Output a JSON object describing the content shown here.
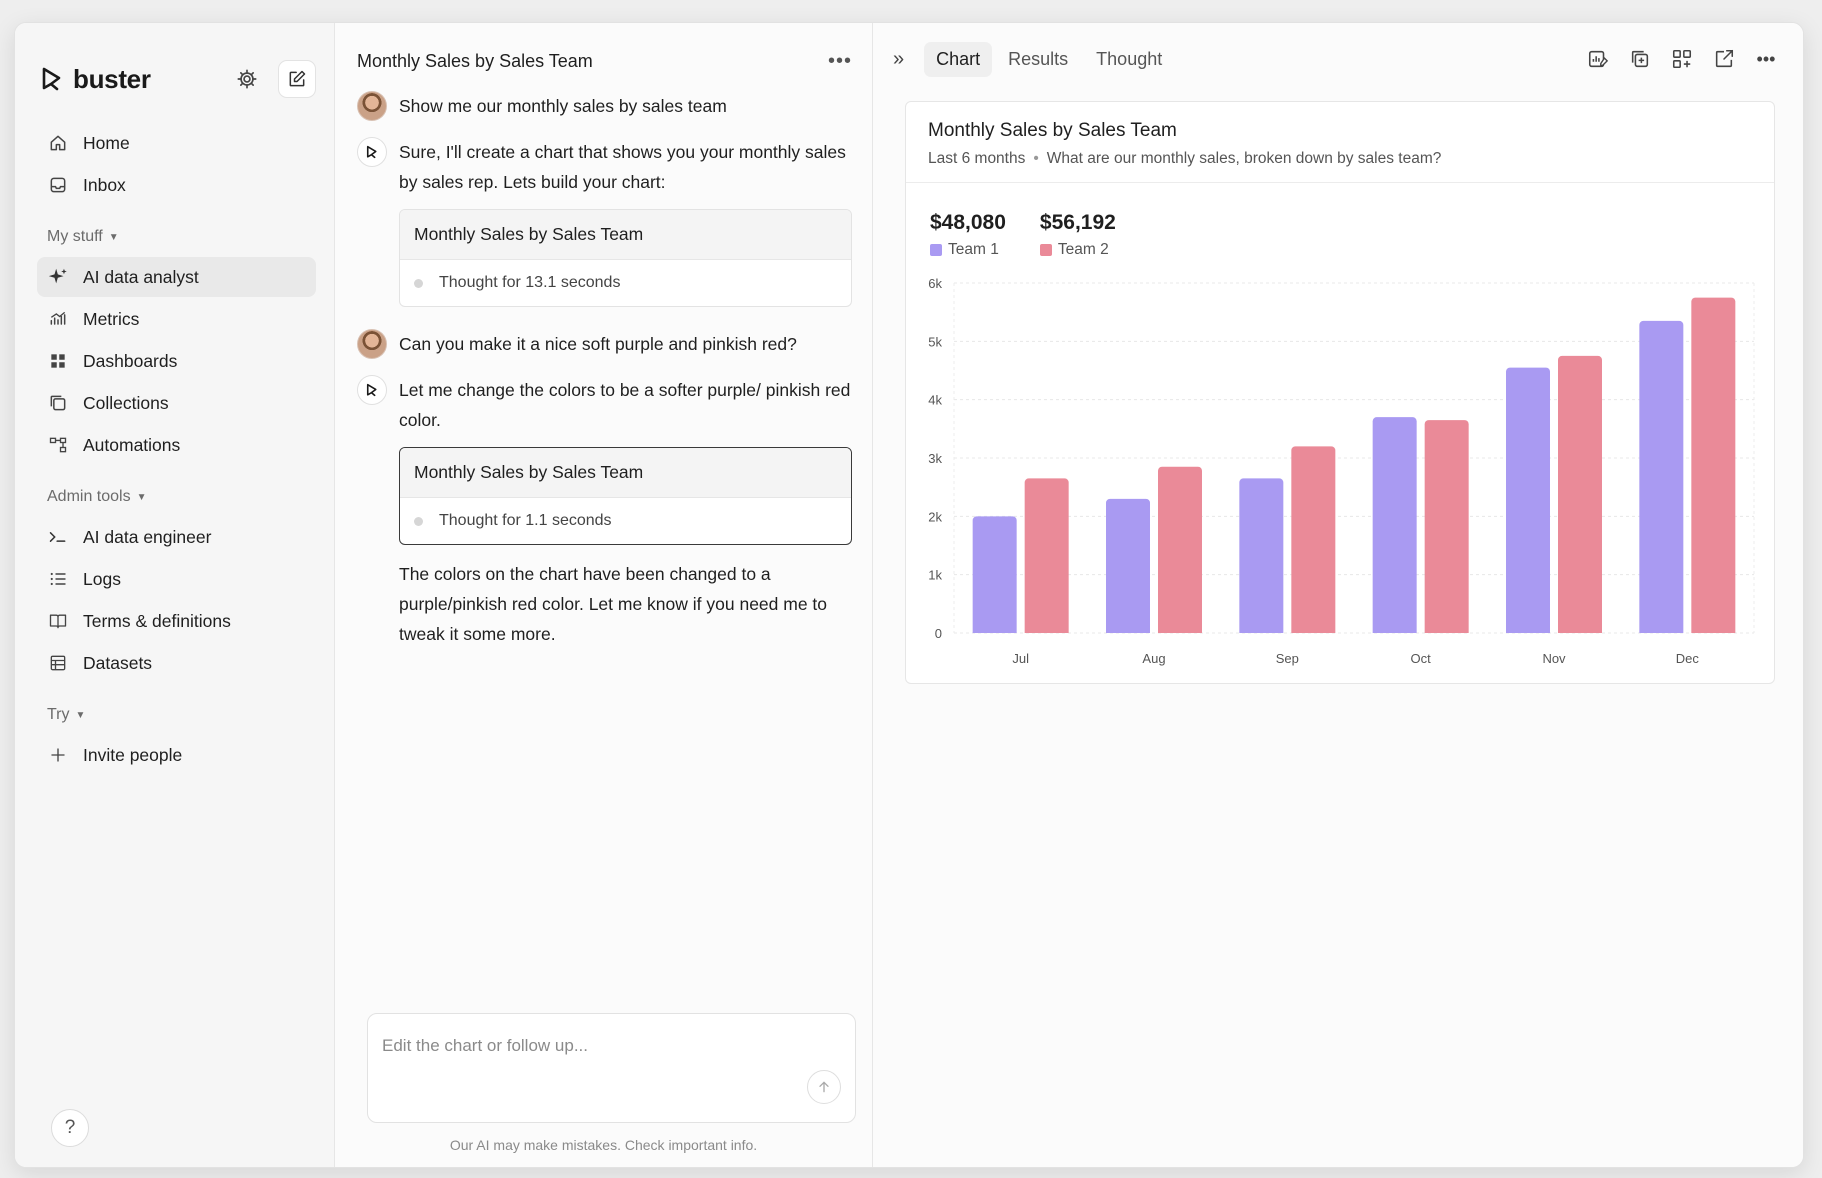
{
  "sidebar": {
    "brand": "buster",
    "nav_primary": [
      {
        "label": "Home"
      },
      {
        "label": "Inbox"
      }
    ],
    "section_my_stuff": "My stuff",
    "my_stuff": [
      {
        "label": "AI data analyst"
      },
      {
        "label": "Metrics"
      },
      {
        "label": "Dashboards"
      },
      {
        "label": "Collections"
      },
      {
        "label": "Automations"
      }
    ],
    "section_admin": "Admin tools",
    "admin": [
      {
        "label": "AI data engineer"
      },
      {
        "label": "Logs"
      },
      {
        "label": "Terms & definitions"
      },
      {
        "label": "Datasets"
      }
    ],
    "section_try": "Try",
    "try": [
      {
        "label": "Invite people"
      }
    ],
    "help": "?"
  },
  "chat": {
    "title": "Monthly Sales by Sales Team",
    "messages": [
      {
        "text": "Show me our monthly sales by sales team"
      },
      {
        "text": "Sure, I'll create a chart that shows you your monthly sales by sales rep. Lets build your chart:",
        "card_title": "Monthly Sales by Sales Team",
        "card_status": "Thought for 13.1 seconds"
      },
      {
        "text": "Can you make it a nice soft purple and pinkish red?"
      },
      {
        "text": "Let me change the colors to be a softer purple/ pinkish red color.",
        "card_title": "Monthly Sales by Sales Team",
        "card_status": "Thought for 1.1 seconds"
      },
      {
        "text": "The colors on the chart have been changed to a purple/pinkish red color. Let me know if you need me to tweak it some more."
      }
    ],
    "input_placeholder": "Edit the chart or follow up...",
    "disclaimer": "Our AI may make mistakes. Check important info."
  },
  "viz": {
    "tabs": [
      "Chart",
      "Results",
      "Thought"
    ],
    "active_tab": "Chart",
    "card_title": "Monthly Sales by Sales Team",
    "subtitle_range": "Last 6 months",
    "subtitle_question": "What are our monthly sales, broken down by sales team?",
    "metrics": [
      {
        "value": "$48,080",
        "label": "Team 1",
        "color": "#a99af2"
      },
      {
        "value": "$56,192",
        "label": "Team 2",
        "color": "#ea8a98"
      }
    ]
  },
  "chart_data": {
    "type": "bar",
    "title": "Monthly Sales by Sales Team",
    "subtitle": "Last 6 months · What are our monthly sales, broken down by sales team?",
    "categories": [
      "Jul",
      "Aug",
      "Sep",
      "Oct",
      "Nov",
      "Dec"
    ],
    "series": [
      {
        "name": "Team 1",
        "color": "#a99af2",
        "values": [
          2000,
          2300,
          2650,
          3700,
          4550,
          5350
        ]
      },
      {
        "name": "Team 2",
        "color": "#ea8a98",
        "values": [
          2650,
          2850,
          3200,
          3650,
          4750,
          5750
        ]
      }
    ],
    "ylim": [
      0,
      6000
    ],
    "yticks": [
      0,
      1000,
      2000,
      3000,
      4000,
      5000,
      6000
    ],
    "ytick_labels": [
      "0",
      "1k",
      "2k",
      "3k",
      "4k",
      "5k",
      "6k"
    ],
    "grid": true,
    "legend": "top-left"
  }
}
